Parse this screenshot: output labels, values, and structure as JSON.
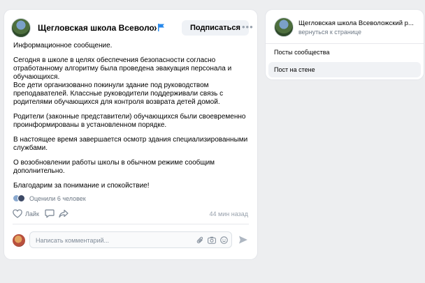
{
  "post": {
    "author": "Щегловская школа Всеволожский рай",
    "subscribe_label": "Подписаться",
    "paragraphs": [
      "Информационное сообщение.",
      "Сегодня в школе в целях обеспечения безопасности согласно отработанному алгоритму была проведена эвакуация персонала и обучающихся.",
      "Все дети организованно покинули здание под руководством преподавателей. Классные руководители поддерживали связь с родителями обучающихся для контроля возврата детей домой.",
      "Родители (законные представители) обучающихся были своевременно проинформированы в установленном порядке.",
      "В настоящее время завершается осмотр здания специализированными службами.",
      "О возобновлении работы школы в обычном режиме сообщим дополнительно.",
      "Благодарим за понимание и спокойствие!"
    ],
    "reactions_text": "Оценили 6 человек",
    "like_label": "Лайк",
    "time": "44 мин назад",
    "comment_placeholder": "Написать комментарий..."
  },
  "sidebar": {
    "title": "Щегловская школа Всеволожский р...",
    "back_link": "вернуться к странице",
    "items": [
      {
        "label": "Посты сообщества"
      },
      {
        "label": "Пост на стене"
      }
    ]
  },
  "colors": {
    "background": "#edeef0",
    "card": "#ffffff",
    "muted_text": "#6d7885",
    "accent": "#2688eb",
    "selected_item": "#f0f2f5"
  },
  "icons": [
    "flag-icon",
    "more-icon",
    "like-icon",
    "comment-icon",
    "share-icon",
    "clip-icon",
    "camera-icon",
    "smile-icon",
    "send-icon"
  ]
}
